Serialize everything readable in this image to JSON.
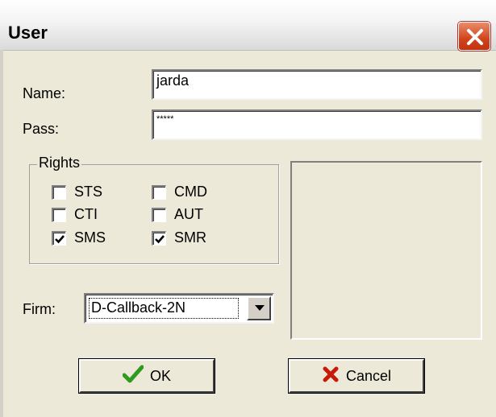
{
  "window": {
    "title": "User",
    "close_icon": "close-icon"
  },
  "form": {
    "name_label": "Name:",
    "name_value": "jarda",
    "pass_label": "Pass:",
    "pass_value": "*****",
    "firm_label": "Firm:",
    "firm_value": "D-Callback-2N"
  },
  "rights": {
    "title": "Rights",
    "items": [
      {
        "label": "STS",
        "checked": false
      },
      {
        "label": "CMD",
        "checked": false
      },
      {
        "label": "CTI",
        "checked": false
      },
      {
        "label": "AUT",
        "checked": false
      },
      {
        "label": "SMS",
        "checked": true
      },
      {
        "label": "SMR",
        "checked": true
      }
    ]
  },
  "buttons": {
    "ok_label": "OK",
    "ok_icon": "checkmark-icon",
    "cancel_label": "Cancel",
    "cancel_icon": "x-icon"
  },
  "colors": {
    "ok_check": "#2f9a1d",
    "cancel_x": "#c8190b",
    "close_button": "#d1441a"
  }
}
